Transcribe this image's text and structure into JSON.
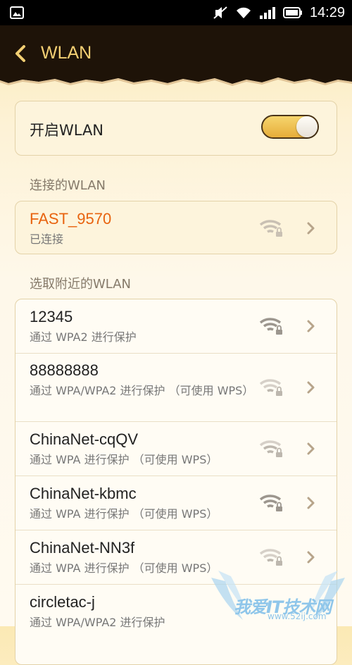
{
  "status_bar": {
    "time": "14:29"
  },
  "header": {
    "title": "WLAN"
  },
  "toggle": {
    "label": "开启WLAN",
    "on": true
  },
  "sections": {
    "connected_label": "连接的WLAN",
    "nearby_label": "选取附近的WLAN"
  },
  "connected": {
    "name": "FAST_9570",
    "status": "已连接"
  },
  "networks": [
    {
      "name": "12345",
      "security": "通过 WPA2 进行保护"
    },
    {
      "name": "88888888",
      "security": "通过 WPA/WPA2 进行保护 （可使用 WPS）"
    },
    {
      "name": "ChinaNet-cqQV",
      "security": "通过 WPA 进行保护 （可使用 WPS）"
    },
    {
      "name": "ChinaNet-kbmc",
      "security": "通过 WPA 进行保护 （可使用 WPS）"
    },
    {
      "name": "ChinaNet-NN3f",
      "security": "通过 WPA 进行保护 （可使用 WPS）"
    },
    {
      "name": "circletac-j",
      "security": "通过 WPA/WPA2 进行保护"
    }
  ],
  "watermark": {
    "text": "我爱IT技术网",
    "url": "www.52ij.com"
  },
  "colors": {
    "accent": "#f3cf73",
    "connected": "#e8630f",
    "header_bg": "#1e1308"
  }
}
